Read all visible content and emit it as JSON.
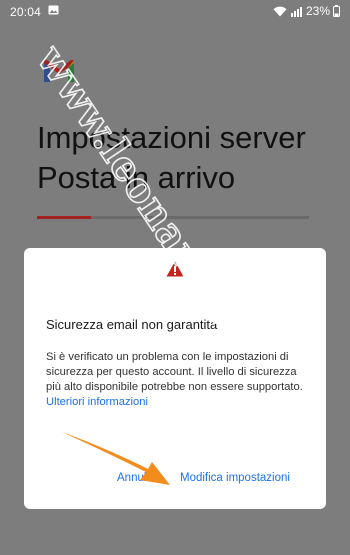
{
  "status_bar": {
    "time": "20:04",
    "battery": "23%"
  },
  "page": {
    "title_line1": "Impostazioni server",
    "title_line2": "Posta in arrivo",
    "progress": 0.2
  },
  "dialog": {
    "title": "Sicurezza email non garantita",
    "body": "Si è verificato un problema con le impostazioni di sicurezza per questo account. Il livello di sicurezza più alto disponibile potrebbe non essere supportato. ",
    "link": "Ulteriori informazioni",
    "cancel_label": "Annulla",
    "modify_label": "Modifica impostazioni"
  },
  "watermark": "www.leonardo.it",
  "colors": {
    "accent": "#1a73e8",
    "arrow": "#f28c1e",
    "progress": "#a32323",
    "warning": "#c5221f"
  },
  "icons": [
    "image-icon",
    "wifi-icon",
    "signal-icon",
    "battery-icon",
    "gmail-logo-icon",
    "warning-icon",
    "arrow-annotation"
  ]
}
